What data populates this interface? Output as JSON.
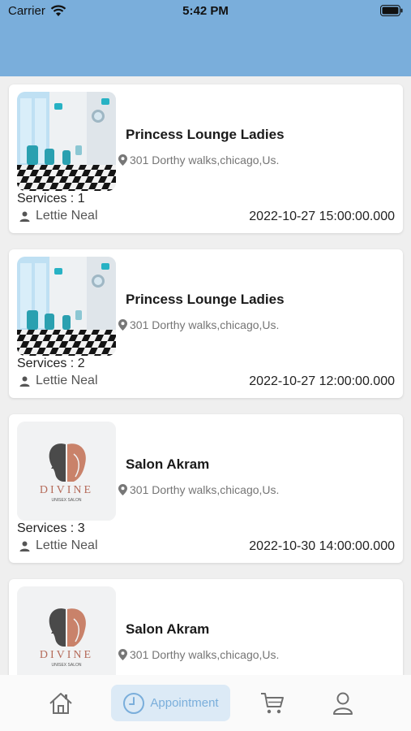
{
  "status": {
    "carrier": "Carrier",
    "time": "5:42 PM"
  },
  "appointments": [
    {
      "salon": "Princess Lounge Ladies",
      "address": "301 Dorthy walks,chicago,Us.",
      "services": "Services : 1",
      "person": "Lettie Neal",
      "datetime": "2022-10-27 15:00:00.000",
      "image": "salon-interior-photo"
    },
    {
      "salon": "Princess Lounge Ladies",
      "address": "301 Dorthy walks,chicago,Us.",
      "services": "Services : 2",
      "person": "Lettie Neal",
      "datetime": "2022-10-27 12:00:00.000",
      "image": "salon-interior-photo"
    },
    {
      "salon": "Salon Akram",
      "address": "301 Dorthy walks,chicago,Us.",
      "services": "Services : 3",
      "person": "Lettie Neal",
      "datetime": "2022-10-30 14:00:00.000",
      "image": "divine-logo",
      "logo_text": "DIVINE",
      "logo_sub": "UNISEX SALON"
    },
    {
      "salon": "Salon Akram",
      "address": "301 Dorthy walks,chicago,Us.",
      "services": "",
      "person": "",
      "datetime": "",
      "image": "divine-logo",
      "logo_text": "DIVINE",
      "logo_sub": "UNISEX SALON"
    }
  ],
  "tabbar": {
    "items": [
      {
        "icon": "home-icon",
        "label": ""
      },
      {
        "icon": "clock-icon",
        "label": "Appointment",
        "active": true
      },
      {
        "icon": "cart-icon",
        "label": ""
      },
      {
        "icon": "profile-icon",
        "label": ""
      }
    ]
  },
  "colors": {
    "header": "#7aaedb",
    "active_tab_bg": "#dceaf6",
    "accent": "#7aaedb"
  }
}
